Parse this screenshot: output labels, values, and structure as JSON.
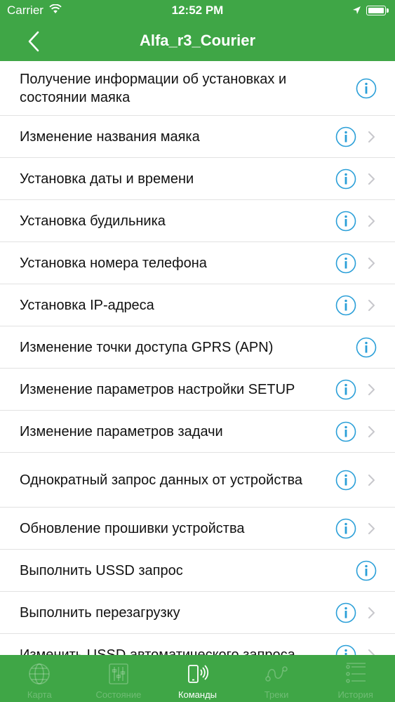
{
  "status_bar": {
    "carrier": "Carrier",
    "time": "12:52 PM"
  },
  "nav": {
    "title": "Alfa_r3_Courier"
  },
  "colors": {
    "accent": "#3fa646",
    "info_icon": "#2a9fd8",
    "chevron": "#c7c7cc"
  },
  "commands": [
    {
      "label": "Получение информации об установках и состоянии маяка",
      "icon": "info-icon",
      "chevron": false
    },
    {
      "label": "Изменение названия маяка",
      "icon": "info-icon",
      "chevron": true
    },
    {
      "label": "Установка даты и времени",
      "icon": "info-icon",
      "chevron": true
    },
    {
      "label": "Установка будильника",
      "icon": "info-icon",
      "chevron": true
    },
    {
      "label": "Установка номера телефона",
      "icon": "info-icon",
      "chevron": true
    },
    {
      "label": "Установка IP-адреса",
      "icon": "info-icon",
      "chevron": true
    },
    {
      "label": "Изменение точки доступа GPRS (APN)",
      "icon": "info-icon",
      "chevron": false
    },
    {
      "label": "Изменение параметров настройки SETUP",
      "icon": "info-icon",
      "chevron": true
    },
    {
      "label": "Изменение параметров задачи",
      "icon": "info-icon",
      "chevron": true
    },
    {
      "label": "Однократный запрос данных от устройства",
      "icon": "info-icon",
      "chevron": true
    },
    {
      "label": "Обновление прошивки устройства",
      "icon": "info-icon",
      "chevron": true
    },
    {
      "label": "Выполнить USSD запрос",
      "icon": "info-icon",
      "chevron": false
    },
    {
      "label": "Выполнить перезагрузку",
      "icon": "info-icon",
      "chevron": true
    },
    {
      "label": "Изменить USSD автоматического запроса",
      "icon": "info-icon",
      "chevron": true
    }
  ],
  "tabs": [
    {
      "label": "Карта",
      "icon": "globe-icon",
      "active": false
    },
    {
      "label": "Состояние",
      "icon": "sliders-icon",
      "active": false
    },
    {
      "label": "Команды",
      "icon": "phone-signal-icon",
      "active": true
    },
    {
      "label": "Треки",
      "icon": "route-icon",
      "active": false
    },
    {
      "label": "История",
      "icon": "list-icon",
      "active": false
    }
  ]
}
